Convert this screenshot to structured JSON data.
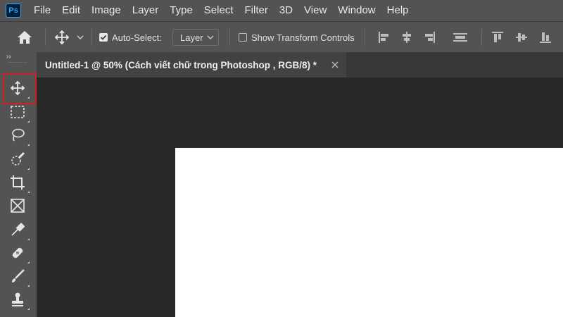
{
  "app": {
    "logo": "Ps",
    "accent": "#31a8ff"
  },
  "menu": [
    "File",
    "Edit",
    "Image",
    "Layer",
    "Type",
    "Select",
    "Filter",
    "3D",
    "View",
    "Window",
    "Help"
  ],
  "options_bar": {
    "auto_select_label": "Auto-Select:",
    "auto_select_checked": true,
    "target_value": "Layer",
    "show_transform_label": "Show Transform Controls",
    "show_transform_checked": false,
    "icons": [
      "home-icon",
      "move-tool-icon",
      "chevron-down-icon",
      "align-left-icon",
      "align-horizontal-center-icon",
      "align-right-icon",
      "align-middle-icon",
      "align-top-icon",
      "align-vertical-center-icon",
      "align-bottom-icon"
    ]
  },
  "document_tab": {
    "title": "Untitled-1 @ 50% (Cách viết chữ trong Photoshop , RGB/8) *"
  },
  "toolbar": {
    "collapse_glyph": "››",
    "tools": [
      "move-tool-icon",
      "marquee-tool-icon",
      "lasso-tool-icon",
      "quick-selection-tool-icon",
      "crop-tool-icon",
      "frame-tool-icon",
      "eyedropper-tool-icon",
      "healing-brush-tool-icon",
      "brush-tool-icon",
      "clone-stamp-tool-icon"
    ],
    "selected_tool": "move-tool-icon",
    "highlight_color": "#d11f26"
  }
}
